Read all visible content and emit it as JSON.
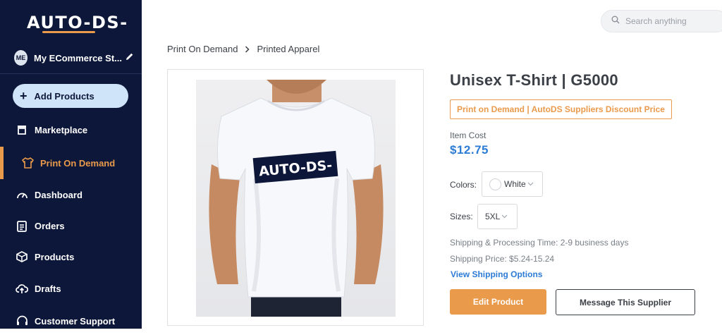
{
  "app": {
    "logo_text": "AUTO-DS-",
    "store_initials": "ME",
    "store_name": "My ECommerce St..."
  },
  "sidebar": {
    "add_label": "Add Products",
    "items": [
      {
        "label": "Marketplace",
        "icon": "store-icon"
      },
      {
        "label": "Print On Demand",
        "icon": "shirt-icon"
      },
      {
        "label": "Dashboard",
        "icon": "gauge-icon"
      },
      {
        "label": "Orders",
        "icon": "clipboard-icon"
      },
      {
        "label": "Products",
        "icon": "box-icon"
      },
      {
        "label": "Drafts",
        "icon": "cloud-upload-icon"
      },
      {
        "label": "Customer Support",
        "icon": "headset-icon"
      }
    ]
  },
  "search": {
    "placeholder": "Search anything"
  },
  "breadcrumb": [
    "Print On Demand",
    "Printed Apparel"
  ],
  "product": {
    "title": "Unisex T-Shirt | G5000",
    "supplier_tag": "Print on Demand | AutoDS Suppliers Discount Price",
    "item_cost_label": "Item Cost",
    "price": "$12.75",
    "colors_label": "Colors:",
    "color_value": "White",
    "sizes_label": "Sizes:",
    "size_value": "5XL",
    "shipping_time": "Shipping & Processing Time: 2-9 business days",
    "shipping_price": "Shipping Price: $5.24-15.24",
    "shipping_link": "View Shipping Options",
    "shirt_print_text": "AUTO-DS-"
  },
  "actions": {
    "edit_label": "Edit Product",
    "message_label": "Message This Supplier"
  },
  "colors": {
    "sidebar_bg": "#0d1739",
    "accent": "#e99a4b",
    "link": "#2c7bd5"
  }
}
